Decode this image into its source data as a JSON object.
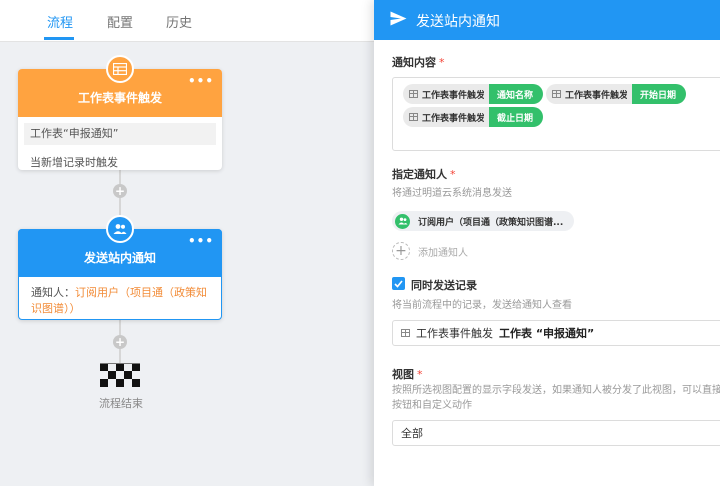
{
  "tabs": [
    {
      "label": "流程",
      "active": true
    },
    {
      "label": "配置",
      "active": false
    },
    {
      "label": "历史",
      "active": false
    }
  ],
  "flow": {
    "trigger_node": {
      "title": "工作表事件触发",
      "table_row": "工作表“申报通知”",
      "condition": "当新增记录时触发",
      "color": "#ffa340"
    },
    "notify_node": {
      "title": "发送站内通知",
      "recipient_label": "通知人：",
      "recipient_value": "订阅用户（项目通（政策知识图谱））",
      "color": "#2196f3"
    },
    "end_label": "流程结束"
  },
  "drawer": {
    "title": "发送站内通知",
    "content_label": "通知内容",
    "content_chips": [
      {
        "source": "工作表事件触发",
        "field": "通知名称"
      },
      {
        "source": "工作表事件触发",
        "field": "开始日期"
      },
      {
        "source": "工作表事件触发",
        "field": "截止日期"
      }
    ],
    "notifier_label": "指定通知人",
    "notifier_hint": "将通过明道云系统消息发送",
    "notifier_user": "订阅用户（项目通（政策知识图谱...",
    "add_notifier": "添加通知人",
    "send_record_label": "同时发送记录",
    "send_record_checked": true,
    "send_record_hint": "将当前流程中的记录，发送给通知人查看",
    "record_source": "工作表事件触发",
    "record_table": "工作表 “申报通知”",
    "view_label": "视图",
    "view_hint": "按照所选视图配置的显示字段发送，如果通知人被分发了此视图，可以直接按钮和自定义动作",
    "view_value": "全部",
    "required_mark": "*"
  },
  "colors": {
    "accent": "#2196f3",
    "orange": "#ffa340",
    "green": "#33c06b"
  }
}
